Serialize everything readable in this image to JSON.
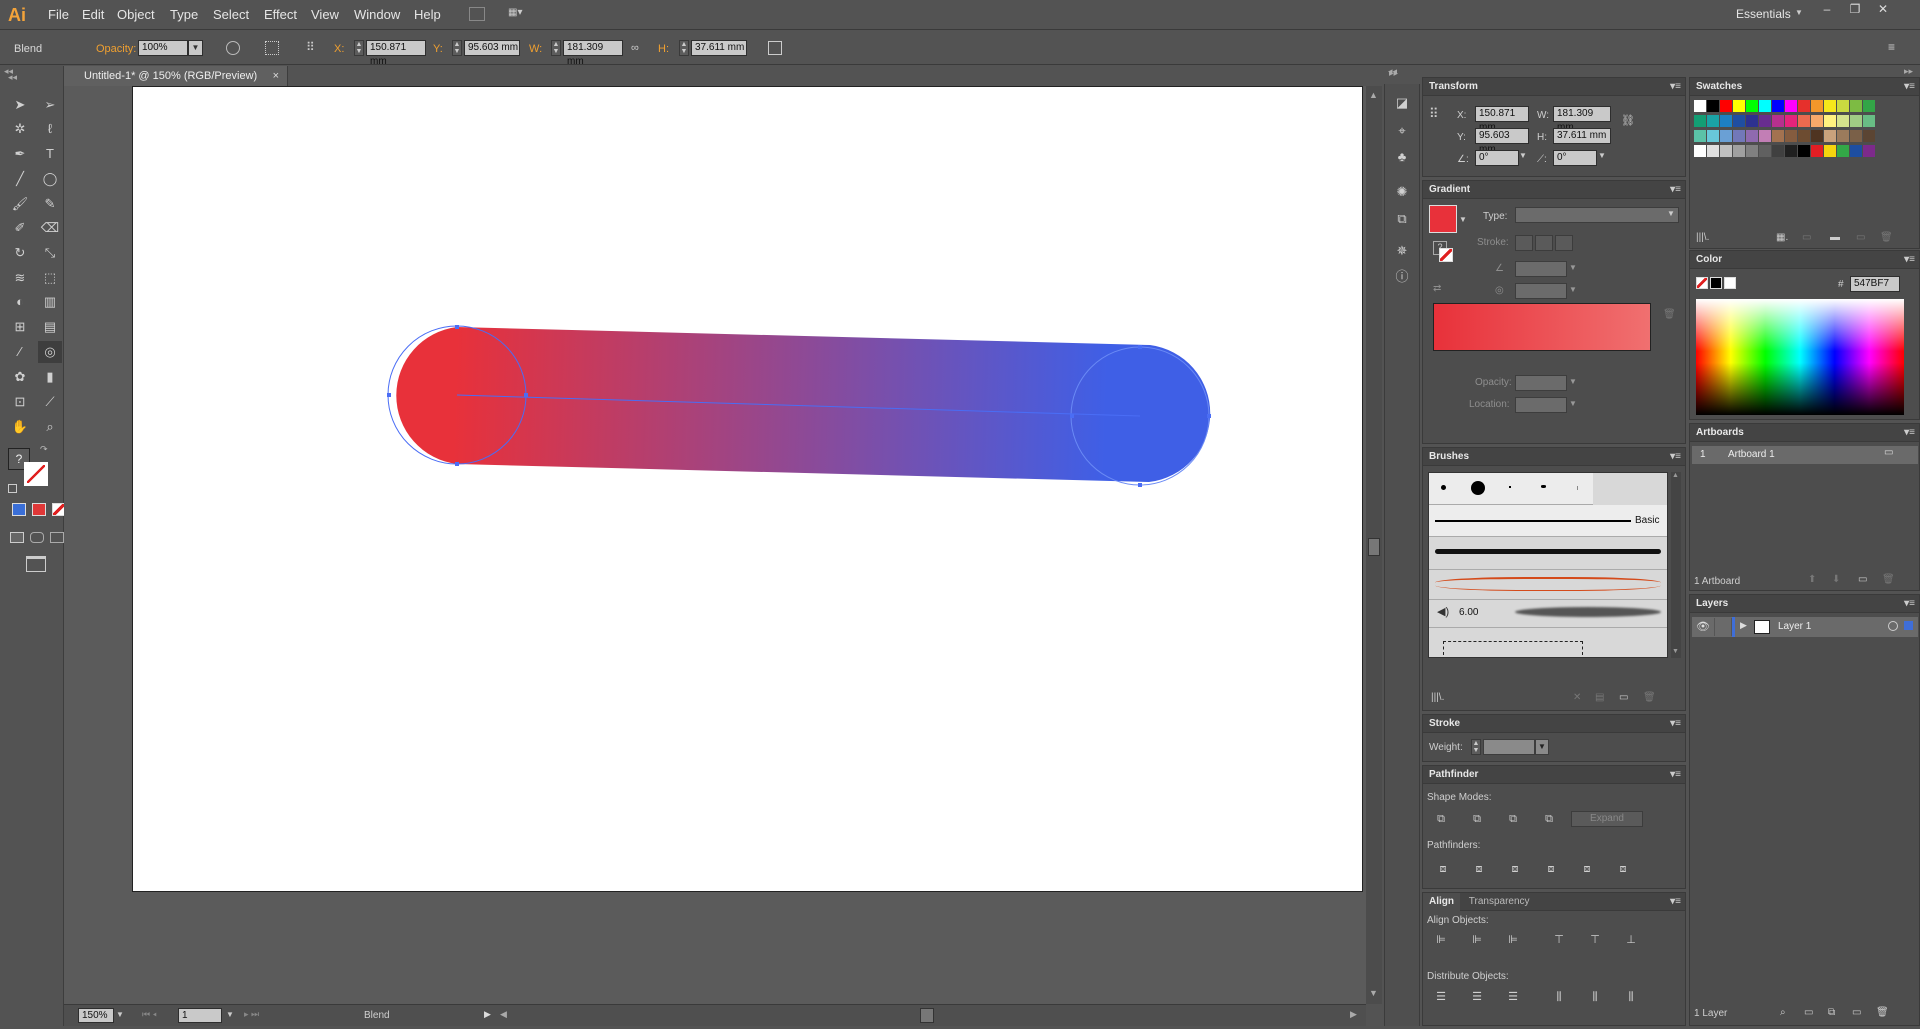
{
  "app": {
    "logo": "Ai",
    "menus": [
      "File",
      "Edit",
      "Object",
      "Type",
      "Select",
      "Effect",
      "View",
      "Window",
      "Help"
    ],
    "workspace": "Essentials",
    "window_controls": [
      "–",
      "❐",
      "✕"
    ]
  },
  "control": {
    "selection_type": "Blend",
    "opacity_label": "Opacity:",
    "opacity_value": "100%",
    "x_label": "X:",
    "x_value": "150.871 mm",
    "y_label": "Y:",
    "y_value": "95.603 mm",
    "w_label": "W:",
    "w_value": "181.309 mm",
    "h_label": "H:",
    "h_value": "37.611 mm"
  },
  "document": {
    "tab_title": "Untitled-1* @ 150% (RGB/Preview)",
    "tab_close": "×"
  },
  "status": {
    "zoom": "150%",
    "artboard_number": "1",
    "status_text": "Blend"
  },
  "transform": {
    "title": "Transform",
    "x_label": "X:",
    "x_value": "150.871 mm",
    "y_label": "Y:",
    "y_value": "95.603 mm",
    "w_label": "W:",
    "w_value": "181.309 mm",
    "h_label": "H:",
    "h_value": "37.611 mm",
    "rotate_value": "0°",
    "shear_value": "0°"
  },
  "gradient": {
    "title": "Gradient",
    "type_label": "Type:",
    "stroke_label": "Stroke:",
    "opacity_label": "Opacity:",
    "location_label": "Location:",
    "start_color": "#e8313a",
    "end_color": "#f07070"
  },
  "brushes": {
    "title": "Brushes",
    "basic_label": "Basic",
    "size_label": "6.00"
  },
  "stroke": {
    "title": "Stroke",
    "weight_label": "Weight:"
  },
  "pathfinder": {
    "title": "Pathfinder",
    "shape_modes_label": "Shape Modes:",
    "expand_label": "Expand",
    "pathfinders_label": "Pathfinders:"
  },
  "align": {
    "title": "Align",
    "tab2": "Transparency",
    "align_objects_label": "Align Objects:",
    "distribute_objects_label": "Distribute Objects:"
  },
  "swatches": {
    "title": "Swatches"
  },
  "color": {
    "title": "Color",
    "hash": "#",
    "hex_value": "547BF7"
  },
  "artboards": {
    "title": "Artboards",
    "items": [
      {
        "num": "1",
        "name": "Artboard 1"
      }
    ],
    "footer": "1 Artboard"
  },
  "layers": {
    "title": "Layers",
    "items": [
      {
        "name": "Layer 1"
      }
    ],
    "footer": "1 Layer"
  },
  "blend_colors": {
    "start": "#e8313a",
    "end": "#3f5fe6"
  }
}
